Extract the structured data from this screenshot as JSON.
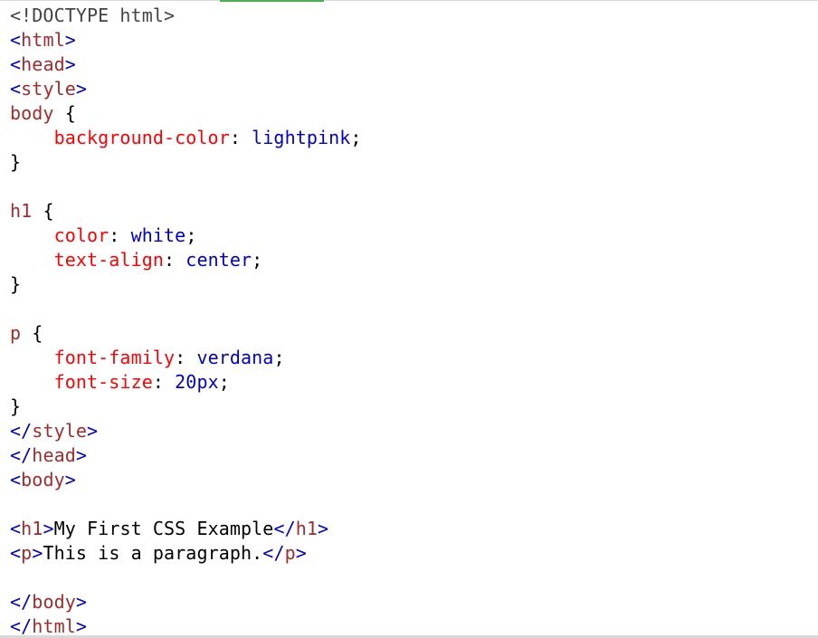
{
  "colors": {
    "plain": "#000000",
    "doctype": "#444444",
    "bracket": "#0000cd",
    "tag": "#a52a2a",
    "selector": "#a52a2a",
    "property": "#ff0000",
    "value": "#0000cd"
  },
  "code_lines": [
    [
      {
        "t": "doctype",
        "v": "<!DOCTYPE html>"
      }
    ],
    [
      {
        "t": "bracket",
        "v": "<"
      },
      {
        "t": "tag",
        "v": "html"
      },
      {
        "t": "bracket",
        "v": ">"
      }
    ],
    [
      {
        "t": "bracket",
        "v": "<"
      },
      {
        "t": "tag",
        "v": "head"
      },
      {
        "t": "bracket",
        "v": ">"
      }
    ],
    [
      {
        "t": "bracket",
        "v": "<"
      },
      {
        "t": "tag",
        "v": "style"
      },
      {
        "t": "bracket",
        "v": ">"
      }
    ],
    [
      {
        "t": "selector",
        "v": "body"
      },
      {
        "t": "plain",
        "v": " {"
      }
    ],
    [
      {
        "t": "plain",
        "v": "    "
      },
      {
        "t": "prop",
        "v": "background-color"
      },
      {
        "t": "plain",
        "v": ": "
      },
      {
        "t": "value",
        "v": "lightpink"
      },
      {
        "t": "plain",
        "v": ";"
      }
    ],
    [
      {
        "t": "plain",
        "v": "}"
      }
    ],
    [],
    [
      {
        "t": "selector",
        "v": "h1"
      },
      {
        "t": "plain",
        "v": " {"
      }
    ],
    [
      {
        "t": "plain",
        "v": "    "
      },
      {
        "t": "prop",
        "v": "color"
      },
      {
        "t": "plain",
        "v": ": "
      },
      {
        "t": "value",
        "v": "white"
      },
      {
        "t": "plain",
        "v": ";"
      }
    ],
    [
      {
        "t": "plain",
        "v": "    "
      },
      {
        "t": "prop",
        "v": "text-align"
      },
      {
        "t": "plain",
        "v": ": "
      },
      {
        "t": "value",
        "v": "center"
      },
      {
        "t": "plain",
        "v": ";"
      }
    ],
    [
      {
        "t": "plain",
        "v": "}"
      }
    ],
    [],
    [
      {
        "t": "selector",
        "v": "p"
      },
      {
        "t": "plain",
        "v": " {"
      }
    ],
    [
      {
        "t": "plain",
        "v": "    "
      },
      {
        "t": "prop",
        "v": "font-family"
      },
      {
        "t": "plain",
        "v": ": "
      },
      {
        "t": "value",
        "v": "verdana"
      },
      {
        "t": "plain",
        "v": ";"
      }
    ],
    [
      {
        "t": "plain",
        "v": "    "
      },
      {
        "t": "prop",
        "v": "font-size"
      },
      {
        "t": "plain",
        "v": ": "
      },
      {
        "t": "value",
        "v": "20px"
      },
      {
        "t": "plain",
        "v": ";"
      }
    ],
    [
      {
        "t": "plain",
        "v": "}"
      }
    ],
    [
      {
        "t": "bracket",
        "v": "</"
      },
      {
        "t": "tag",
        "v": "style"
      },
      {
        "t": "bracket",
        "v": ">"
      }
    ],
    [
      {
        "t": "bracket",
        "v": "</"
      },
      {
        "t": "tag",
        "v": "head"
      },
      {
        "t": "bracket",
        "v": ">"
      }
    ],
    [
      {
        "t": "bracket",
        "v": "<"
      },
      {
        "t": "tag",
        "v": "body"
      },
      {
        "t": "bracket",
        "v": ">"
      }
    ],
    [],
    [
      {
        "t": "bracket",
        "v": "<"
      },
      {
        "t": "tag",
        "v": "h1"
      },
      {
        "t": "bracket",
        "v": ">"
      },
      {
        "t": "text",
        "v": "My First CSS Example"
      },
      {
        "t": "bracket",
        "v": "</"
      },
      {
        "t": "tag",
        "v": "h1"
      },
      {
        "t": "bracket",
        "v": ">"
      }
    ],
    [
      {
        "t": "bracket",
        "v": "<"
      },
      {
        "t": "tag",
        "v": "p"
      },
      {
        "t": "bracket",
        "v": ">"
      },
      {
        "t": "text",
        "v": "This is a paragraph."
      },
      {
        "t": "bracket",
        "v": "</"
      },
      {
        "t": "tag",
        "v": "p"
      },
      {
        "t": "bracket",
        "v": ">"
      }
    ],
    [],
    [
      {
        "t": "bracket",
        "v": "</"
      },
      {
        "t": "tag",
        "v": "body"
      },
      {
        "t": "bracket",
        "v": ">"
      }
    ],
    [
      {
        "t": "bracket",
        "v": "</"
      },
      {
        "t": "tag",
        "v": "html"
      },
      {
        "t": "bracket",
        "v": ">"
      }
    ]
  ]
}
